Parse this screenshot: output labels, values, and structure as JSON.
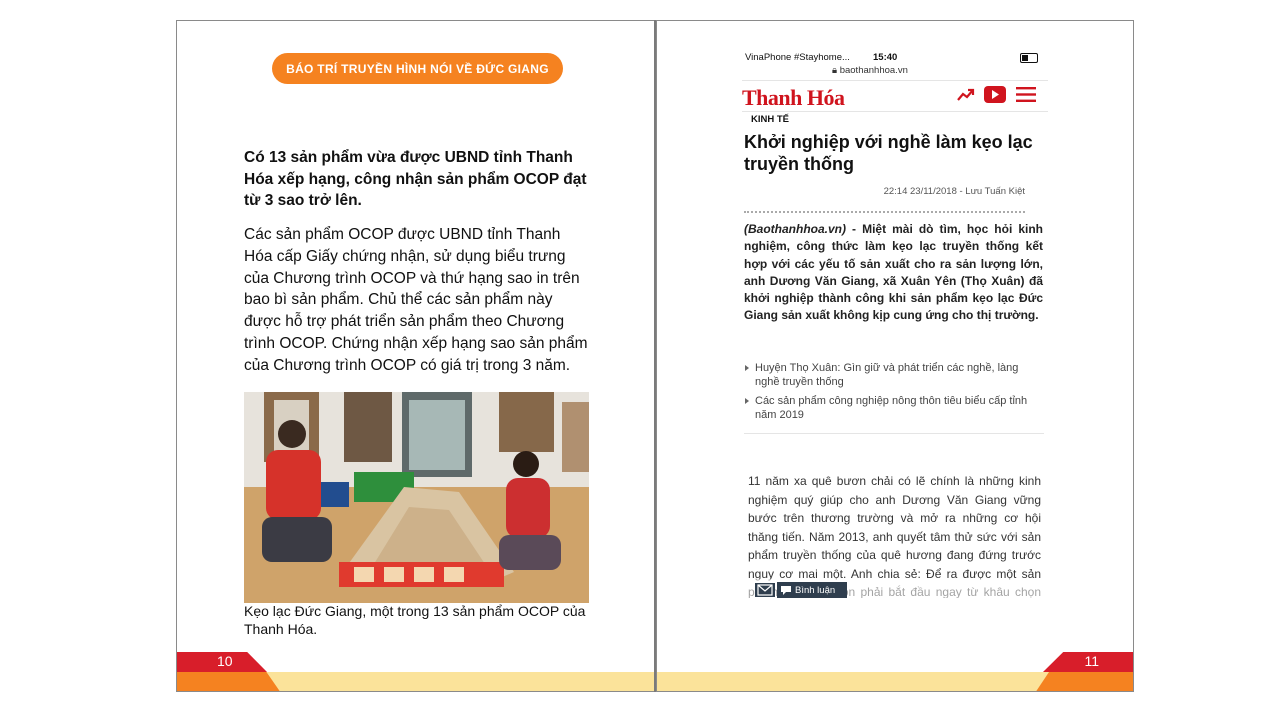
{
  "left_page": {
    "banner": "BÁO TRÍ TRUYỀN HÌNH NÓI VỀ ĐỨC GIANG",
    "lead": "Có 13 sản phẩm vừa được UBND tỉnh Thanh Hóa xếp hạng, công nhận sản phẩm OCOP đạt từ 3 sao trở lên.",
    "body": "Các sản phẩm OCOP được UBND tỉnh Thanh Hóa cấp Giấy chứng nhận, sử dụng biểu trưng của Chương trình OCOP và thứ hạng sao in trên bao bì sản phẩm. Chủ thể các sản phẩm này được hỗ trợ phát triển sản phẩm theo Chương trình OCOP. Chứng nhận xếp hạng sao sản phẩm của Chương trình OCOP có giá trị trong 3 năm.",
    "caption": "Kẹo lạc Đức Giang, một trong 13 sản phẩm OCOP của Thanh Hóa.",
    "page_number": "10"
  },
  "right_page": {
    "status": {
      "carrier": "VinaPhone #Stayhome...",
      "time": "15:40"
    },
    "url": "baothanhhoa.vn",
    "logo": "Thanh Hóa",
    "category": "KINH TẾ",
    "headline": "Khởi nghiệp với nghề làm kẹo lạc truyền thống",
    "meta": "22:14 23/11/2018 - Lưu Tuấn Kiệt",
    "sapo_source": "(Baothanhhoa.vn)",
    "sapo_text": " - Miệt mài dò tìm, học hỏi kinh nghiệm, công thức làm kẹo lạc truyền thống kết hợp với các yếu tố sản xuất cho ra sản lượng lớn, anh Dương Văn Giang, xã Xuân Yên (Thọ Xuân) đã khởi nghiệp thành công khi sản phẩm kẹo lạc Đức Giang sản xuất không kịp cung ứng cho thị trường.",
    "related": [
      "Huyện Thọ Xuân: Gìn giữ và phát triển các nghề, làng nghề truyền thống",
      "Các sản phẩm công nghiệp nông thôn tiêu biểu cấp tỉnh năm 2019"
    ],
    "article": "11 năm xa quê bươn chải có lẽ chính là những kinh nghiệm quý giúp cho anh Dương Văn Giang vững bước trên thương trường và mở ra những cơ hội thăng tiến. Năm 2013, anh quyết tâm thử sức với sản phẩm truyền thống của quê hương đang đứng trước nguy cơ mai một. Anh chia sẻ: Để ra được một sản phẩm kẹo lạc ngon phải bắt đầu ngay từ khâu chọn lựa nguyên liệu.",
    "comment_label": "Bình luận",
    "page_number": "11"
  },
  "colors": {
    "accent_orange": "#f58220",
    "accent_red": "#d81e2a",
    "footer_yellow": "#fbe39a",
    "logo_red": "#d0141e"
  }
}
